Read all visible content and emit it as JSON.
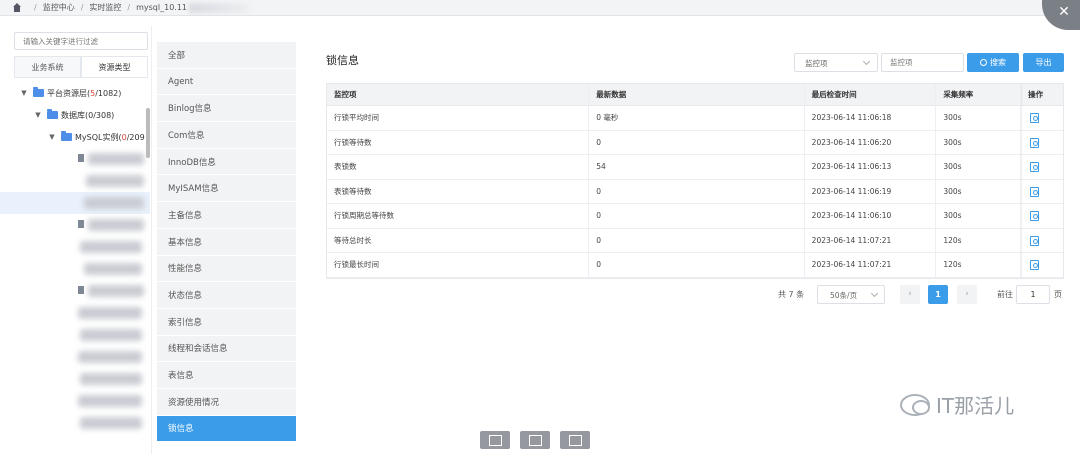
{
  "breadcrumb": {
    "items": [
      "监控中心",
      "实时监控",
      "mysql_10.11"
    ]
  },
  "close_glyph": "✕",
  "left_panel": {
    "search_placeholder": "请输入关键字进行过滤",
    "tabs": [
      "业务系统",
      "资源类型"
    ],
    "tree": [
      {
        "label": "平台资源层(",
        "count": "5",
        "suffix": "/1082)"
      },
      {
        "label": "数据库(0/308)"
      },
      {
        "label": "MySQL实例(",
        "count": "0",
        "suffix": "/209"
      }
    ]
  },
  "menu": {
    "items": [
      "全部",
      "Agent",
      "Binlog信息",
      "Com信息",
      "InnoDB信息",
      "MyISAM信息",
      "主备信息",
      "基本信息",
      "性能信息",
      "状态信息",
      "索引信息",
      "线程和会话信息",
      "表信息",
      "资源使用情况",
      "锁信息"
    ],
    "active": "锁信息"
  },
  "main": {
    "title": "锁信息",
    "select_value": "监控项",
    "monitor_placeholder": "监控项",
    "search_button": "搜索",
    "export_button": "导出",
    "columns": [
      "监控项",
      "最新数据",
      "最后检查时间",
      "采集频率",
      "操作"
    ],
    "rows": [
      [
        "行锁平均时间",
        "0 毫秒",
        "2023-06-14 11:06:18",
        "300s"
      ],
      [
        "行锁等待数",
        "0",
        "2023-06-14 11:06:20",
        "300s"
      ],
      [
        "表锁数",
        "54",
        "2023-06-14 11:06:13",
        "300s"
      ],
      [
        "表锁等待数",
        "0",
        "2023-06-14 11:06:19",
        "300s"
      ],
      [
        "行锁周期总等待数",
        "0",
        "2023-06-14 11:06:10",
        "300s"
      ],
      [
        "等待总时长",
        "0",
        "2023-06-14 11:07:21",
        "120s"
      ],
      [
        "行锁最长时间",
        "0",
        "2023-06-14 11:07:21",
        "120s"
      ]
    ],
    "operation_icon": "view-detail-icon"
  },
  "pagination": {
    "total": "共 7 条",
    "page_size": "50条/页",
    "prev": "‹",
    "next": "›",
    "current_page": "1",
    "goto_label": "前往",
    "goto_value": "1",
    "page_unit": "页"
  },
  "watermark": "IT那活儿",
  "colors": {
    "accent": "#3b9cea",
    "red": "#e0463c"
  }
}
